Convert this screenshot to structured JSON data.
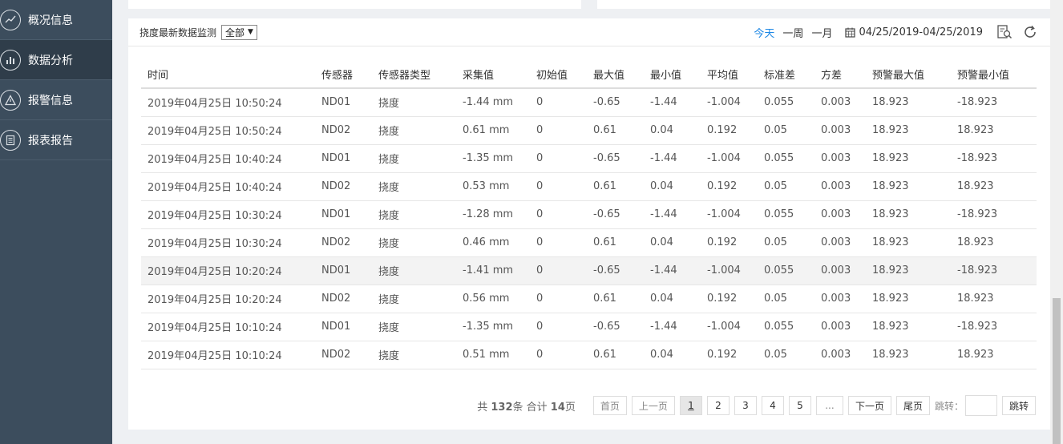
{
  "sidebar": {
    "items": [
      {
        "label": "概况信息",
        "icon": "line-chart-icon",
        "active": false
      },
      {
        "label": "数据分析",
        "icon": "bar-chart-icon",
        "active": true
      },
      {
        "label": "报警信息",
        "icon": "warning-icon",
        "active": false
      },
      {
        "label": "报表报告",
        "icon": "report-icon",
        "active": false
      }
    ]
  },
  "panel": {
    "title": "挠度最新数据监测",
    "filter_value": "全部",
    "ranges": [
      "今天",
      "一周",
      "一月"
    ],
    "active_range": "今天",
    "date_range": "04/25/2019-04/25/2019"
  },
  "table": {
    "headers": [
      "时间",
      "传感器",
      "传感器类型",
      "采集值",
      "初始值",
      "最大值",
      "最小值",
      "平均值",
      "标准差",
      "方差",
      "预警最大值",
      "预警最小值"
    ],
    "rows": [
      [
        "2019年04月25日 10:50:24",
        "ND01",
        "挠度",
        "-1.44 mm",
        "0",
        "-0.65",
        "-1.44",
        "-1.004",
        "0.055",
        "0.003",
        "18.923",
        "-18.923"
      ],
      [
        "2019年04月25日 10:50:24",
        "ND02",
        "挠度",
        "0.61 mm",
        "0",
        "0.61",
        "0.04",
        "0.192",
        "0.05",
        "0.003",
        "18.923",
        "18.923"
      ],
      [
        "2019年04月25日 10:40:24",
        "ND01",
        "挠度",
        "-1.35 mm",
        "0",
        "-0.65",
        "-1.44",
        "-1.004",
        "0.055",
        "0.003",
        "18.923",
        "-18.923"
      ],
      [
        "2019年04月25日 10:40:24",
        "ND02",
        "挠度",
        "0.53 mm",
        "0",
        "0.61",
        "0.04",
        "0.192",
        "0.05",
        "0.003",
        "18.923",
        "18.923"
      ],
      [
        "2019年04月25日 10:30:24",
        "ND01",
        "挠度",
        "-1.28 mm",
        "0",
        "-0.65",
        "-1.44",
        "-1.004",
        "0.055",
        "0.003",
        "18.923",
        "-18.923"
      ],
      [
        "2019年04月25日 10:30:24",
        "ND02",
        "挠度",
        "0.46 mm",
        "0",
        "0.61",
        "0.04",
        "0.192",
        "0.05",
        "0.003",
        "18.923",
        "18.923"
      ],
      [
        "2019年04月25日 10:20:24",
        "ND01",
        "挠度",
        "-1.41 mm",
        "0",
        "-0.65",
        "-1.44",
        "-1.004",
        "0.055",
        "0.003",
        "18.923",
        "-18.923"
      ],
      [
        "2019年04月25日 10:20:24",
        "ND02",
        "挠度",
        "0.56 mm",
        "0",
        "0.61",
        "0.04",
        "0.192",
        "0.05",
        "0.003",
        "18.923",
        "18.923"
      ],
      [
        "2019年04月25日 10:10:24",
        "ND01",
        "挠度",
        "-1.35 mm",
        "0",
        "-0.65",
        "-1.44",
        "-1.004",
        "0.055",
        "0.003",
        "18.923",
        "-18.923"
      ],
      [
        "2019年04月25日 10:10:24",
        "ND02",
        "挠度",
        "0.51 mm",
        "0",
        "0.61",
        "0.04",
        "0.192",
        "0.05",
        "0.003",
        "18.923",
        "18.923"
      ]
    ],
    "highlight_row": 6
  },
  "pager": {
    "prefix": "共",
    "total": "132",
    "mid": "条 合计",
    "pages": "14",
    "suffix": "页",
    "first": "首页",
    "prev": "上一页",
    "numbers": [
      "1",
      "2",
      "3",
      "4",
      "5"
    ],
    "current": "1",
    "ellipsis": "...",
    "next": "下一页",
    "last": "尾页",
    "jump_label": "跳转：",
    "jump_button": "跳转"
  },
  "colors": {
    "sidebar_bg": "#3c4d5d",
    "sidebar_active": "#2f3d4a",
    "accent": "#1e88e5"
  }
}
